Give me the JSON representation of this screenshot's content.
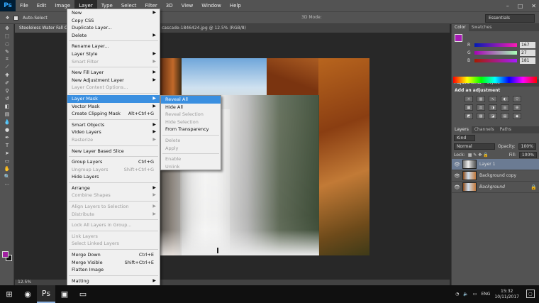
{
  "menubar": {
    "logo": "Ps",
    "items": [
      "File",
      "Edit",
      "Image",
      "Layer",
      "Type",
      "Select",
      "Filter",
      "3D",
      "View",
      "Window",
      "Help"
    ],
    "window_controls": [
      "–",
      "□",
      "✕"
    ]
  },
  "options": {
    "auto_select": "Auto-Select",
    "mode_3d": "3D Mode:",
    "workspace": "Essentials"
  },
  "tabs": {
    "doc1": "Steeleless Water Fall C...",
    "doc2_title": "cascade-1846424.jpg @ 12.5% (RGB/8)"
  },
  "layer_menu": {
    "items": [
      {
        "label": "New",
        "sub": true
      },
      {
        "label": "Copy CSS"
      },
      {
        "label": "Duplicate Layer..."
      },
      {
        "label": "Delete",
        "sub": true
      },
      {
        "sep": true
      },
      {
        "label": "Rename Layer..."
      },
      {
        "label": "Layer Style",
        "sub": true
      },
      {
        "label": "Smart Filter",
        "disabled": true,
        "sub": true
      },
      {
        "sep": true
      },
      {
        "label": "New Fill Layer",
        "sub": true
      },
      {
        "label": "New Adjustment Layer",
        "sub": true
      },
      {
        "label": "Layer Content Options...",
        "disabled": true
      },
      {
        "sep": true
      },
      {
        "label": "Layer Mask",
        "sub": true,
        "highlight": true
      },
      {
        "label": "Vector Mask",
        "sub": true
      },
      {
        "label": "Create Clipping Mask",
        "shortcut": "Alt+Ctrl+G"
      },
      {
        "sep": true
      },
      {
        "label": "Smart Objects",
        "sub": true
      },
      {
        "label": "Video Layers",
        "sub": true
      },
      {
        "label": "Rasterize",
        "disabled": true,
        "sub": true
      },
      {
        "sep": true
      },
      {
        "label": "New Layer Based Slice"
      },
      {
        "sep": true
      },
      {
        "label": "Group Layers",
        "shortcut": "Ctrl+G"
      },
      {
        "label": "Ungroup Layers",
        "shortcut": "Shift+Ctrl+G",
        "disabled": true
      },
      {
        "label": "Hide Layers"
      },
      {
        "sep": true
      },
      {
        "label": "Arrange",
        "sub": true
      },
      {
        "label": "Combine Shapes",
        "disabled": true,
        "sub": true
      },
      {
        "sep": true
      },
      {
        "label": "Align Layers to Selection",
        "disabled": true,
        "sub": true
      },
      {
        "label": "Distribute",
        "disabled": true,
        "sub": true
      },
      {
        "sep": true
      },
      {
        "label": "Lock All Layers in Group...",
        "disabled": true
      },
      {
        "sep": true
      },
      {
        "label": "Link Layers",
        "disabled": true
      },
      {
        "label": "Select Linked Layers",
        "disabled": true
      },
      {
        "sep": true
      },
      {
        "label": "Merge Down",
        "shortcut": "Ctrl+E"
      },
      {
        "label": "Merge Visible",
        "shortcut": "Shift+Ctrl+E"
      },
      {
        "label": "Flatten Image"
      },
      {
        "sep": true
      },
      {
        "label": "Matting",
        "sub": true
      }
    ]
  },
  "mask_submenu": {
    "items": [
      {
        "label": "Reveal All",
        "highlight": true
      },
      {
        "label": "Hide All"
      },
      {
        "label": "Reveal Selection",
        "disabled": true
      },
      {
        "label": "Hide Selection",
        "disabled": true
      },
      {
        "label": "From Transparency"
      },
      {
        "sep": true
      },
      {
        "label": "Delete",
        "disabled": true
      },
      {
        "label": "Apply",
        "disabled": true
      },
      {
        "sep": true
      },
      {
        "label": "Enable",
        "disabled": true
      },
      {
        "label": "Unlink",
        "disabled": true
      }
    ]
  },
  "color_panel": {
    "tabs": [
      "Color",
      "Swatches"
    ],
    "r": "167",
    "g": "27",
    "b": "181",
    "fg_color": "#a71bb5"
  },
  "adjustments": {
    "tabs": [
      "Adjustments",
      "Styles"
    ],
    "title": "Add an adjustment"
  },
  "layers_panel": {
    "tabs": [
      "Layers",
      "Channels",
      "Paths"
    ],
    "kind": "Kind",
    "blend": "Normal",
    "opacity_label": "Opacity:",
    "opacity": "100%",
    "lock_label": "Lock:",
    "fill_label": "Fill:",
    "fill": "100%",
    "layers": [
      {
        "name": "Layer 1",
        "selected": true
      },
      {
        "name": "Background copy"
      },
      {
        "name": "Background",
        "locked": true
      }
    ]
  },
  "status": {
    "zoom": "12.5%"
  },
  "taskbar": {
    "lang": "ENG",
    "time": "15:32",
    "date": "10/11/2017"
  }
}
